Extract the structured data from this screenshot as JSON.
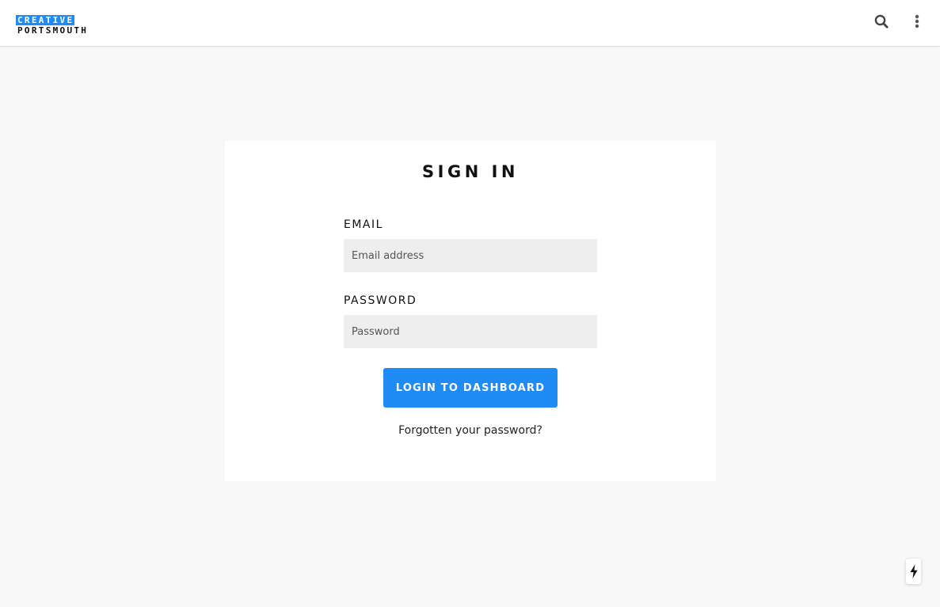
{
  "header": {
    "logo_line1": "CREATIVE",
    "logo_line2": "PORTSMOUTH",
    "search_icon": "search-icon",
    "menu_icon": "more-vertical-icon"
  },
  "signin": {
    "title": "SIGN IN",
    "email_label": "EMAIL",
    "email_placeholder": "Email address",
    "email_value": "",
    "password_label": "PASSWORD",
    "password_placeholder": "Password",
    "password_value": "",
    "submit_label": "LOGIN TO DASHBOARD",
    "forgot_link": "Forgotten your password?"
  },
  "floating": {
    "icon": "lightning-bolt-icon"
  },
  "colors": {
    "accent": "#1f8bf5",
    "page_background": "#f8f8f8",
    "card_background": "#ffffff",
    "input_background": "#eeeeee"
  }
}
